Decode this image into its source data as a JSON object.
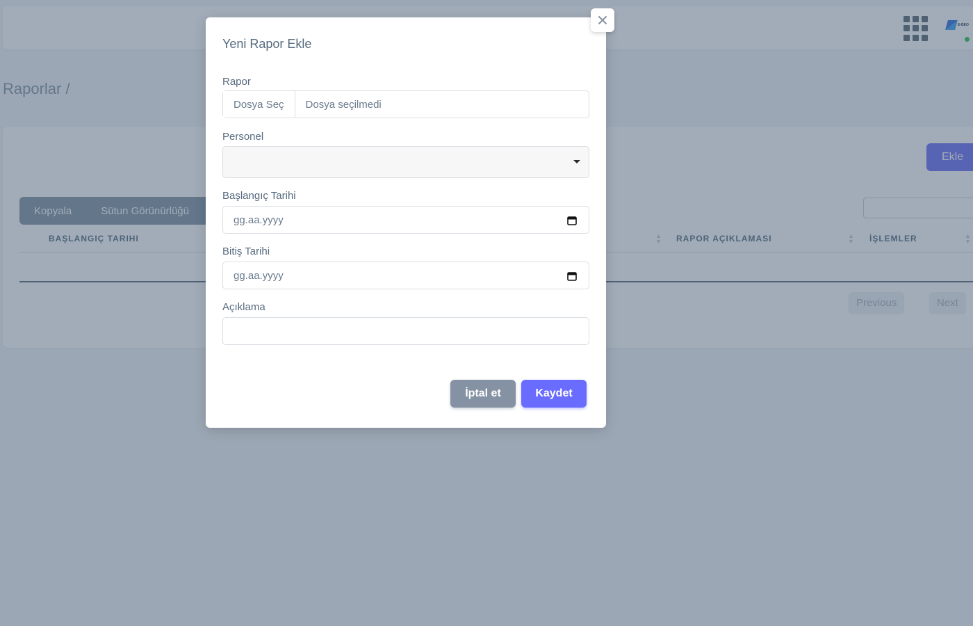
{
  "page": {
    "heading": "Raporlar /",
    "add_button": "Ekle",
    "toolbar": {
      "copy": "Kopyala",
      "column_visibility": "Sütun Görünürlüğü"
    },
    "table": {
      "columns": [
        "BAŞLANGIÇ TARIHI",
        "RAPOR AÇIKLAMASI",
        "İŞLEMLER"
      ]
    },
    "pagination": {
      "previous": "Previous",
      "next": "Next"
    },
    "brand": {
      "logo_text": "E-BEO"
    }
  },
  "modal": {
    "title": "Yeni Rapor Ekle",
    "report_label": "Rapor",
    "file_button": "Dosya Seç",
    "file_status": "Dosya seçilmedi",
    "personnel_label": "Personel",
    "personnel_value": "",
    "start_date_label": "Başlangıç Tarihi",
    "start_date_placeholder": "gg.aa.yyyy",
    "end_date_label": "Bitiş Tarihi",
    "end_date_placeholder": "gg.aa.yyyy",
    "description_label": "Açıklama",
    "description_value": "",
    "cancel_button": "İptal et",
    "save_button": "Kaydet"
  },
  "colors": {
    "primary": "#696cff",
    "secondary": "#8592a3",
    "text": "#566a7f",
    "online": "#2ec24a"
  }
}
